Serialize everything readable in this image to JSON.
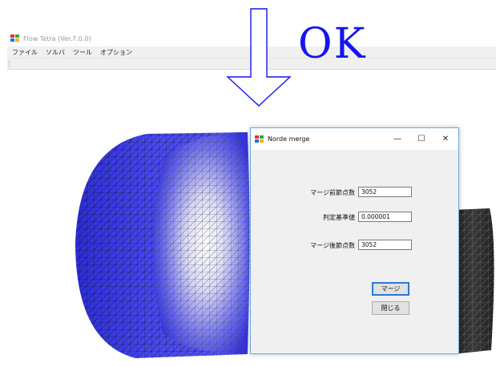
{
  "app": {
    "title": "Flow Tetra  (Ver.7.0.0)",
    "menu": [
      "ファイル",
      "ソルバ",
      "ツール",
      "オプション"
    ]
  },
  "overlay": {
    "ok_text": "OK",
    "arrow_color": "#1515ee"
  },
  "dialog": {
    "title": "Norde merge",
    "controls": {
      "minimize": "—",
      "maximize": "☐",
      "close": "✕"
    },
    "fields": {
      "before_label": "マージ前節点数",
      "before_value": "3052",
      "threshold_label": "判定基準値",
      "threshold_value": "0.000001",
      "after_label": "マージ後節点数",
      "after_value": "3052"
    },
    "buttons": {
      "merge": "マージ",
      "close": "閉じる"
    }
  },
  "mesh": {
    "left_color": "#3a3ae6",
    "right_color": "#2b2b2b"
  }
}
